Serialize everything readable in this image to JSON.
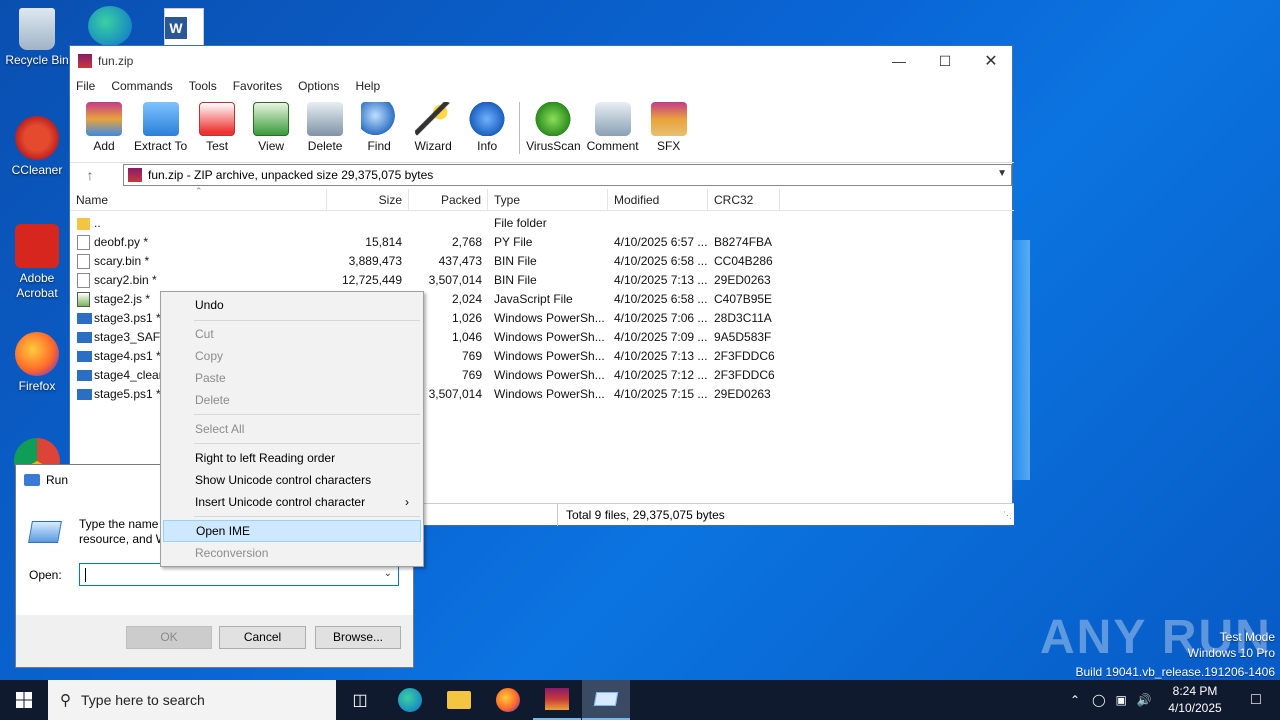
{
  "desktop": {
    "icons": [
      {
        "label": "Recycle Bin"
      },
      {
        "label": "CCleaner"
      },
      {
        "label": "Adobe Acrobat"
      },
      {
        "label": "Firefox"
      }
    ]
  },
  "winrar": {
    "title": "fun.zip",
    "menu": [
      "File",
      "Commands",
      "Tools",
      "Favorites",
      "Options",
      "Help"
    ],
    "toolbar": [
      "Add",
      "Extract To",
      "Test",
      "View",
      "Delete",
      "Find",
      "Wizard",
      "Info",
      "VirusScan",
      "Comment",
      "SFX"
    ],
    "address": "fun.zip - ZIP archive, unpacked size 29,375,075 bytes",
    "columns": [
      "Name",
      "Size",
      "Packed",
      "Type",
      "Modified",
      "CRC32"
    ],
    "rows": [
      {
        "name": "..",
        "size": "",
        "packed": "",
        "type": "File folder",
        "modified": "",
        "crc": ""
      },
      {
        "name": "deobf.py *",
        "size": "15,814",
        "packed": "2,768",
        "type": "PY File",
        "modified": "4/10/2025 6:57 ...",
        "crc": "B8274FBA"
      },
      {
        "name": "scary.bin *",
        "size": "3,889,473",
        "packed": "437,473",
        "type": "BIN File",
        "modified": "4/10/2025 6:58 ...",
        "crc": "CC04B286"
      },
      {
        "name": "scary2.bin *",
        "size": "12,725,449",
        "packed": "3,507,014",
        "type": "BIN File",
        "modified": "4/10/2025 7:13 ...",
        "crc": "29ED0263"
      },
      {
        "name": "stage2.js *",
        "size": "",
        "packed": "2,024",
        "type": "JavaScript File",
        "modified": "4/10/2025 6:58 ...",
        "crc": "C407B95E"
      },
      {
        "name": "stage3.ps1 *",
        "size": "",
        "packed": "1,026",
        "type": "Windows PowerSh...",
        "modified": "4/10/2025 7:06 ...",
        "crc": "28D3C11A"
      },
      {
        "name": "stage3_SAFE.",
        "size": "",
        "packed": "1,046",
        "type": "Windows PowerSh...",
        "modified": "4/10/2025 7:09 ...",
        "crc": "9A5D583F"
      },
      {
        "name": "stage4.ps1 *",
        "size": "",
        "packed": "769",
        "type": "Windows PowerSh...",
        "modified": "4/10/2025 7:13 ...",
        "crc": "2F3FDDC6"
      },
      {
        "name": "stage4_clean",
        "size": "",
        "packed": "769",
        "type": "Windows PowerSh...",
        "modified": "4/10/2025 7:12 ...",
        "crc": "2F3FDDC6"
      },
      {
        "name": "stage5.ps1 *",
        "size": "",
        "packed": "3,507,014",
        "type": "Windows PowerSh...",
        "modified": "4/10/2025 7:15 ...",
        "crc": "29ED0263"
      }
    ],
    "status": "Total 9 files, 29,375,075 bytes"
  },
  "run": {
    "title": "Run",
    "desc_line1": "Type the name",
    "desc_line2": "resource, and W",
    "open_label": "Open:",
    "ok": "OK",
    "cancel": "Cancel",
    "browse": "Browse..."
  },
  "context_menu": {
    "undo": "Undo",
    "cut": "Cut",
    "copy": "Copy",
    "paste": "Paste",
    "delete": "Delete",
    "select_all": "Select All",
    "rtl": "Right to left Reading order",
    "show_unicode": "Show Unicode control characters",
    "insert_unicode": "Insert Unicode control character",
    "open_ime": "Open IME",
    "reconversion": "Reconversion"
  },
  "taskbar": {
    "search_placeholder": "Type here to search",
    "time": "8:24 PM",
    "date": "4/10/2025"
  },
  "watermark": {
    "brand": "ANY RUN",
    "line1": "Test Mode",
    "line2": "Windows 10 Pro",
    "line3": "Build 19041.vb_release.191206-1406"
  },
  "colors": {
    "accent": "#0078d7",
    "menu_highlight": "#cde8ff",
    "taskbar": "#0f1a2e"
  }
}
